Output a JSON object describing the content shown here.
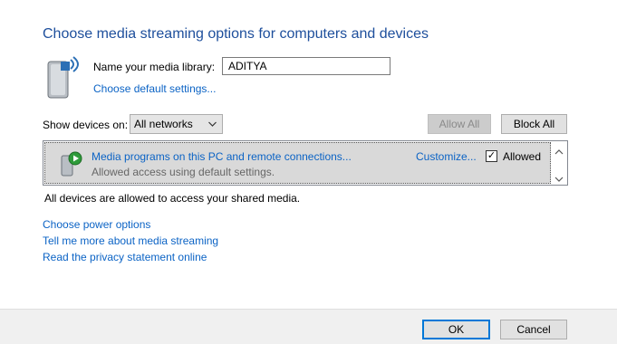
{
  "page": {
    "title": "Choose media streaming options for computers and devices"
  },
  "library": {
    "label": "Name your media library:",
    "value": "ADITYA",
    "default_settings_link": "Choose default settings...",
    "icon": "media-library-icon"
  },
  "devices": {
    "show_label": "Show devices on:",
    "network_selected": "All networks",
    "allow_all_label": "Allow All",
    "block_all_label": "Block All",
    "items": [
      {
        "name": "Media programs on this PC and remote connections...",
        "subtitle": "Allowed access using default settings.",
        "customize_label": "Customize...",
        "allowed_label": "Allowed",
        "allowed_checked": true,
        "icon": "media-device-icon"
      }
    ],
    "status_text": "All devices are allowed to access your shared media."
  },
  "links": {
    "power": "Choose power options",
    "tell_more": "Tell me more about media streaming",
    "privacy": "Read the privacy statement online"
  },
  "footer": {
    "ok_label": "OK",
    "cancel_label": "Cancel"
  },
  "colors": {
    "title": "#1e4f9c",
    "link": "#0b63c5",
    "accent": "#0078d7",
    "selected_row": "#d9d9d9"
  }
}
